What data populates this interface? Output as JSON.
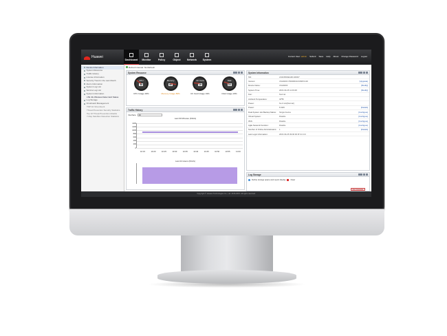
{
  "brand": {
    "name": "Huawei",
    "sub": "HUAWEI"
  },
  "nav": [
    {
      "label": "Dashboard",
      "icon": "dashboard-icon",
      "active": true
    },
    {
      "label": "Monitor",
      "icon": "monitor-icon"
    },
    {
      "label": "Policy",
      "icon": "policy-icon"
    },
    {
      "label": "Object",
      "icon": "object-icon"
    },
    {
      "label": "Network",
      "icon": "network-icon"
    },
    {
      "label": "System",
      "icon": "system-icon"
    }
  ],
  "topright": {
    "current_user_label": "Current User:",
    "user": "admin",
    "links": [
      "Submit",
      "Save",
      "Help",
      "About",
      "Change Password",
      "Logout"
    ]
  },
  "sidebar": {
    "items": [
      {
        "label": "Device Information",
        "active": true
      },
      {
        "label": "System Resource"
      },
      {
        "label": "Traffic History"
      },
      {
        "label": "License Information"
      },
      {
        "label": "Security Trend in the Last Month"
      },
      {
        "label": "Alarm Information"
      },
      {
        "label": "System Log List"
      },
      {
        "label": "Service Log List"
      },
      {
        "label": "System Information"
      },
      {
        "label": "LTE 4G Wireless Data Card Status",
        "sub": true
      },
      {
        "label": "Log Storage"
      },
      {
        "label": "Virusboard Management"
      },
      {
        "label": "TOP 10 Virus Event",
        "sub": true
      },
      {
        "label": "Threat Prevention Security Statistics",
        "sub": true
      },
      {
        "label": "Top 10 Threat Prevention Attacks",
        "sub": true
      },
      {
        "label": "7-Day Sandbox Detection Statistics",
        "sub": true
      }
    ]
  },
  "refresh": {
    "label": "Refresh interval:",
    "value": "No Refresh"
  },
  "system_resource": {
    "title": "System Resource",
    "gauges": [
      {
        "name": "CPU",
        "value": "30",
        "caption": "CPU Usage 30%",
        "level": 0.3,
        "warn": false
      },
      {
        "name": "Memory",
        "value": "86",
        "caption": "Memory Usage 86%",
        "level": 0.86,
        "warn": true
      },
      {
        "name": "CF Card",
        "value": "19",
        "caption": "CF Card Usage 19%",
        "level": 0.19,
        "warn": false
      },
      {
        "name": "Disk",
        "value": "23",
        "caption": "Disk Usage 23%",
        "level": 0.23,
        "warn": false
      }
    ]
  },
  "traffic_history": {
    "title": "Traffic History",
    "interface_label": "Interface",
    "interface_value": "All",
    "chart1_title": "Last 60 Minutes (Kbit/s)",
    "chart2_title": "Last 24 Hours (Kbit/s)"
  },
  "chart_data": [
    {
      "type": "area",
      "title": "Last 60 Minutes (Kbit/s)",
      "ylabel": "",
      "xlabel": "",
      "categories": [
        "10:15",
        "10:20",
        "10:25",
        "10:30",
        "10:35",
        "10:40",
        "10:45",
        "10:50",
        "10:55",
        "11:00"
      ],
      "y_ticks": [
        "1400",
        "1200",
        "1000",
        "800",
        "600",
        "400",
        "200",
        "0"
      ],
      "ylim": [
        0,
        1400
      ],
      "series": [
        {
          "values": [
            920,
            920,
            920,
            920,
            920,
            920,
            920,
            920,
            920,
            920
          ]
        }
      ]
    },
    {
      "type": "area",
      "title": "Last 24 Hours (Kbit/s)",
      "categories": [],
      "series": [
        {
          "values": []
        }
      ]
    }
  ],
  "system_information": {
    "title": "System Information",
    "rows": [
      {
        "label": "SN:",
        "value": "2102350DEG6K100007",
        "link": ""
      },
      {
        "label": "Version:",
        "value": "USG6000 V500R001C60SPC100",
        "link": "[Upgrade]"
      },
      {
        "label": "Device Name:",
        "value": "USG6000",
        "link": "[Modify]"
      },
      {
        "label": "System Time:",
        "value": "2015-09-25 11:03:48",
        "link": "[Modify]"
      },
      {
        "label": "Fan:",
        "value": "Normal",
        "link": ""
      },
      {
        "label": "Ambient Temperature:",
        "value": "32℃",
        "link": ""
      },
      {
        "label": "Power:",
        "value": "No.0 slot[Normal]",
        "link": ""
      },
      {
        "label": "Power:",
        "value": "8.4kW",
        "link": "[Details]"
      },
      {
        "label": "Dual-System Hot Backup Status:",
        "value": "Single Device",
        "link": "[Configure]"
      },
      {
        "label": "Virtual System:",
        "value": "Disable",
        "link": "[Configure]"
      },
      {
        "label": "IPv6:",
        "value": "Disable",
        "link": "[Configure]"
      },
      {
        "label": "Agile Network Function:",
        "value": "Disable",
        "link": "[Configure]"
      },
      {
        "label": "Number of Online Administrators:",
        "value": "1",
        "link": "[Details]"
      },
      {
        "label": "Last Login Information:",
        "value": "2015-09-25 09:00:00 IP:0.0.0.0",
        "link": ""
      }
    ]
  },
  "log_storage": {
    "title": "Log Storage",
    "define_label": "Define storage space and report display",
    "clear_label": "Clear",
    "cli_label": "CLI Console"
  },
  "footer": {
    "text": "Copyright © Huawei Technologies Co., Ltd. 2015-2015. All rights reserved."
  }
}
